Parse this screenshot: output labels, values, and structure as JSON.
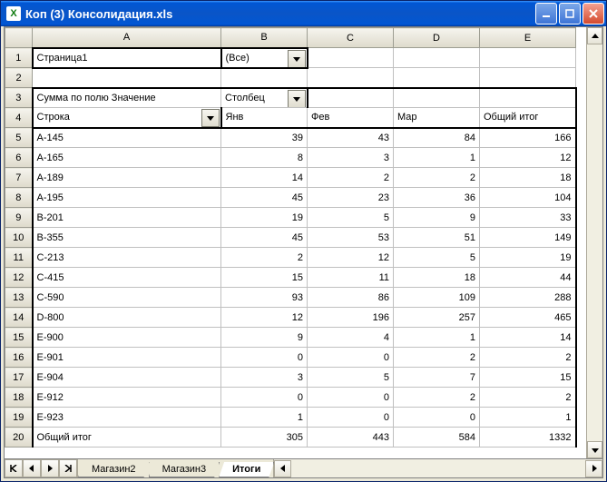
{
  "window": {
    "title": "Коп (3) Консолидация.xls",
    "app_icon_letter": "X"
  },
  "columns": [
    "A",
    "B",
    "C",
    "D",
    "E"
  ],
  "row_headers": [
    "1",
    "2",
    "3",
    "4",
    "5",
    "6",
    "7",
    "8",
    "9",
    "10",
    "11",
    "12",
    "13",
    "14",
    "15",
    "16",
    "17",
    "18",
    "19",
    "20"
  ],
  "pivot": {
    "page_field_label": "Страница1",
    "page_field_value": "(Все)",
    "data_field_label": "Сумма по полю Значение",
    "column_field_label": "Столбец",
    "row_field_label": "Строка",
    "col_headers": [
      "Янв",
      "Фев",
      "Мар",
      "Общий итог"
    ],
    "rows": [
      {
        "label": "A-145",
        "vals": [
          "39",
          "43",
          "84",
          "166"
        ]
      },
      {
        "label": "A-165",
        "vals": [
          "8",
          "3",
          "1",
          "12"
        ]
      },
      {
        "label": "A-189",
        "vals": [
          "14",
          "2",
          "2",
          "18"
        ]
      },
      {
        "label": "A-195",
        "vals": [
          "45",
          "23",
          "36",
          "104"
        ]
      },
      {
        "label": "B-201",
        "vals": [
          "19",
          "5",
          "9",
          "33"
        ]
      },
      {
        "label": "B-355",
        "vals": [
          "45",
          "53",
          "51",
          "149"
        ]
      },
      {
        "label": "C-213",
        "vals": [
          "2",
          "12",
          "5",
          "19"
        ]
      },
      {
        "label": "C-415",
        "vals": [
          "15",
          "11",
          "18",
          "44"
        ]
      },
      {
        "label": "C-590",
        "vals": [
          "93",
          "86",
          "109",
          "288"
        ]
      },
      {
        "label": "D-800",
        "vals": [
          "12",
          "196",
          "257",
          "465"
        ]
      },
      {
        "label": "E-900",
        "vals": [
          "9",
          "4",
          "1",
          "14"
        ]
      },
      {
        "label": "E-901",
        "vals": [
          "0",
          "0",
          "2",
          "2"
        ]
      },
      {
        "label": "E-904",
        "vals": [
          "3",
          "5",
          "7",
          "15"
        ]
      },
      {
        "label": "E-912",
        "vals": [
          "0",
          "0",
          "2",
          "2"
        ]
      },
      {
        "label": "E-923",
        "vals": [
          "1",
          "0",
          "0",
          "1"
        ]
      }
    ],
    "grand_total_label": "Общий итог",
    "grand_total_vals": [
      "305",
      "443",
      "584",
      "1332"
    ]
  },
  "sheet_tabs": [
    "Магазин2",
    "Магазин3",
    "Итоги"
  ],
  "active_tab_index": 2,
  "chart_data": {
    "type": "table",
    "title": "Сумма по полю Значение",
    "row_field": "Строка",
    "column_field": "Столбец",
    "page_field": "Страница1",
    "page_value": "(Все)",
    "columns": [
      "Янв",
      "Фев",
      "Мар",
      "Общий итог"
    ],
    "rows": [
      {
        "label": "A-145",
        "values": [
          39,
          43,
          84,
          166
        ]
      },
      {
        "label": "A-165",
        "values": [
          8,
          3,
          1,
          12
        ]
      },
      {
        "label": "A-189",
        "values": [
          14,
          2,
          2,
          18
        ]
      },
      {
        "label": "A-195",
        "values": [
          45,
          23,
          36,
          104
        ]
      },
      {
        "label": "B-201",
        "values": [
          19,
          5,
          9,
          33
        ]
      },
      {
        "label": "B-355",
        "values": [
          45,
          53,
          51,
          149
        ]
      },
      {
        "label": "C-213",
        "values": [
          2,
          12,
          5,
          19
        ]
      },
      {
        "label": "C-415",
        "values": [
          15,
          11,
          18,
          44
        ]
      },
      {
        "label": "C-590",
        "values": [
          93,
          86,
          109,
          288
        ]
      },
      {
        "label": "D-800",
        "values": [
          12,
          196,
          257,
          465
        ]
      },
      {
        "label": "E-900",
        "values": [
          9,
          4,
          1,
          14
        ]
      },
      {
        "label": "E-901",
        "values": [
          0,
          0,
          2,
          2
        ]
      },
      {
        "label": "E-904",
        "values": [
          3,
          5,
          7,
          15
        ]
      },
      {
        "label": "E-912",
        "values": [
          0,
          0,
          2,
          2
        ]
      },
      {
        "label": "E-923",
        "values": [
          1,
          0,
          0,
          1
        ]
      }
    ],
    "grand_total": {
      "label": "Общий итог",
      "values": [
        305,
        443,
        584,
        1332
      ]
    }
  }
}
